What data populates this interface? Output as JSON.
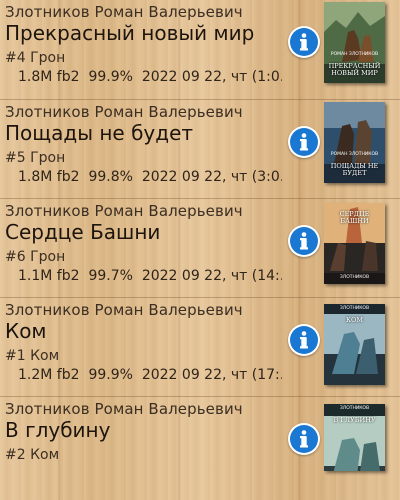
{
  "books": [
    {
      "author": "Злотников Роман Валерьевич",
      "title": "Прекрасный новый мир",
      "series": "#4 Грон",
      "size": "1.8M",
      "format": "fb2",
      "percent": "99.9%",
      "date": "2022 09 22, чт (1:0…",
      "cover_title": "Прекрасный новый мир",
      "cover_author": "Роман Злотников",
      "cover_colors": [
        "#3f6a4a",
        "#a9a36a",
        "#5b3a22"
      ]
    },
    {
      "author": "Злотников Роман Валерьевич",
      "title": "Пощады не будет",
      "series": "#5 Грон",
      "size": "1.8M",
      "format": "fb2",
      "percent": "99.8%",
      "date": "2022 09 22, чт (3:0…",
      "cover_title": "Пощады не будет",
      "cover_author": "Роман Злотников",
      "cover_colors": [
        "#2e4f6b",
        "#6d8aa0",
        "#3a2a20"
      ]
    },
    {
      "author": "Злотников Роман Валерьевич",
      "title": "Сердце Башни",
      "series": "#6 Грон",
      "size": "1.1M",
      "format": "fb2",
      "percent": "99.7%",
      "date": "2022 09 22, чт (14:…",
      "cover_title": "Сердце Башни",
      "cover_author": "Злотников",
      "cover_colors": [
        "#b9643a",
        "#e0b27a",
        "#2a2624"
      ]
    },
    {
      "author": "Злотников Роман Валерьевич",
      "title": "Ком",
      "series": "#1 Ком",
      "size": "1.2M",
      "format": "fb2",
      "percent": "99.9%",
      "date": "2022 09 22, чт (17:…",
      "cover_title": "Ком",
      "cover_author": "Злотников",
      "cover_colors": [
        "#4f7f93",
        "#9ab7c2",
        "#24333c"
      ]
    },
    {
      "author": "Злотников Роман Валерьевич",
      "title": "В глубину",
      "series": "#2 Ком",
      "size": "",
      "format": "",
      "percent": "",
      "date": "",
      "cover_title": "В глубину",
      "cover_author": "Злотников",
      "cover_colors": [
        "#5f8c8a",
        "#b4ccc2",
        "#2c3b3e"
      ]
    }
  ],
  "icons": {
    "info": "info-icon",
    "info_color": "#1a78d2"
  }
}
